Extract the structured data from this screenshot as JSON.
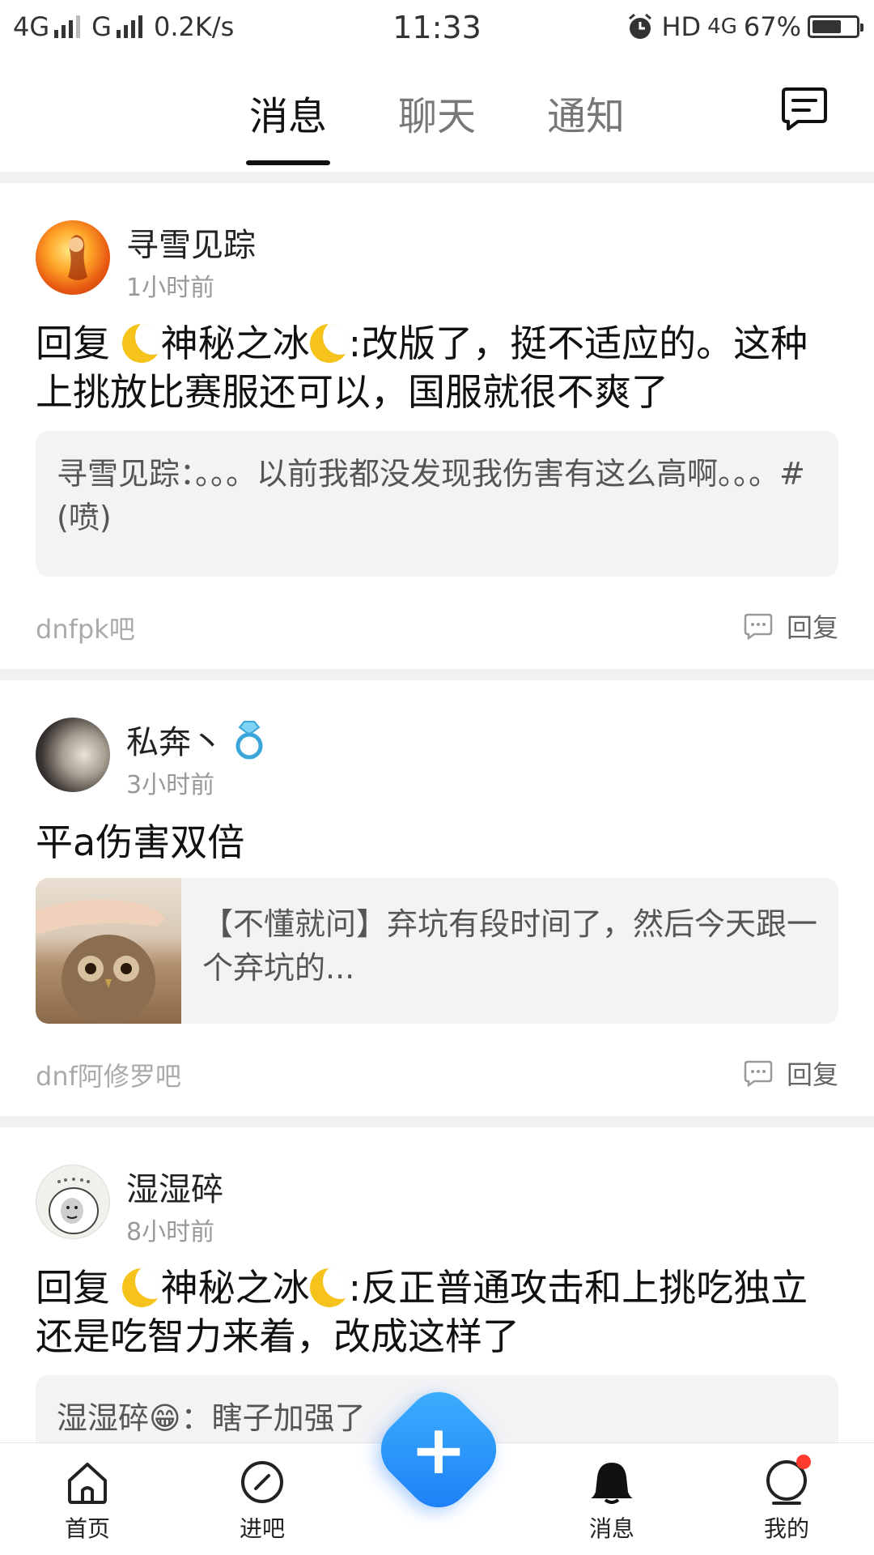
{
  "status": {
    "net1": "4G",
    "net2": "G",
    "speed": "0.2K/s",
    "time": "11:33",
    "hd": "HD",
    "net_right": "4G",
    "battery": "67%",
    "battery_level": 0.67
  },
  "tabs": [
    {
      "label": "消息"
    },
    {
      "label": "聊天"
    },
    {
      "label": "通知"
    }
  ],
  "posts": [
    {
      "user": "寻雪见踪",
      "time": "1小时前",
      "content": {
        "prefix": "回复",
        "mention": "神秘之冰",
        "text": ":改版了，挺不适应的。这种上挑放比赛服还可以，国服就很不爽了"
      },
      "quote": "寻雪见踪：。。。以前我都没发现我伤害有这么高啊。。。#(喷)",
      "forum": "dnfpk吧",
      "reply_label": "回复"
    },
    {
      "user": "私奔丶",
      "time": "3小时前",
      "content": {
        "text": "平a伤害双倍"
      },
      "quote": "【不懂就问】弃坑有段时间了，然后今天跟一个弃坑的...",
      "forum": "dnf阿修罗吧",
      "reply_label": "回复"
    },
    {
      "user": "湿湿碎",
      "time": "8小时前",
      "content": {
        "prefix": "回复",
        "mention": "神秘之冰",
        "text": ":反正普通攻击和上挑吃独立还是吃智力来着，改成这样了"
      },
      "quote": "湿湿碎😁：瞎子加强了"
    }
  ],
  "nav": [
    {
      "label": "首页"
    },
    {
      "label": "进吧"
    },
    {
      "label": "消息"
    },
    {
      "label": "我的"
    }
  ],
  "fab": "+"
}
